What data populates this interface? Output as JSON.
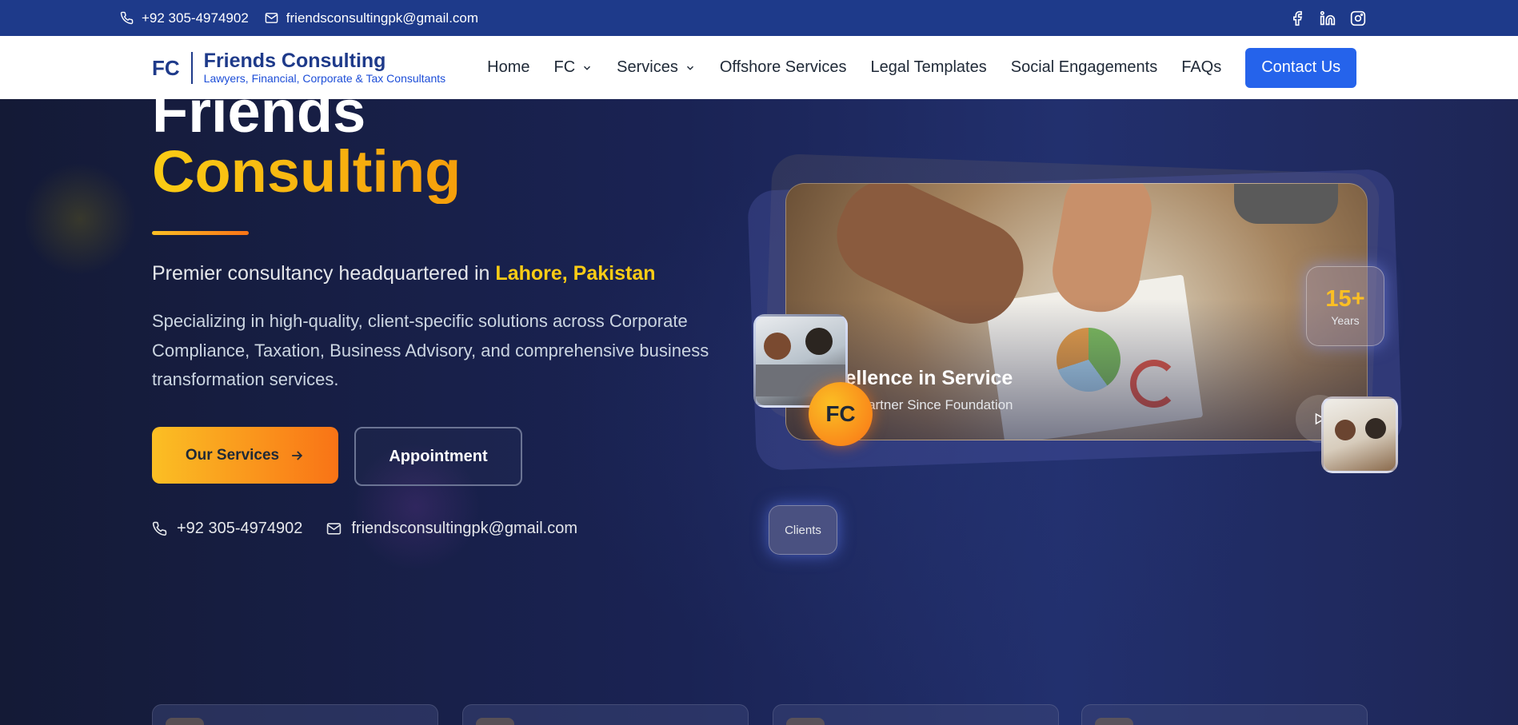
{
  "topbar": {
    "phone": "+92 305-4974902",
    "email": "friendsconsultingpk@gmail.com",
    "social": [
      "facebook-icon",
      "linkedin-icon",
      "instagram-icon"
    ]
  },
  "header": {
    "logo_mark": "FC",
    "brand_name": "Friends Consulting",
    "tagline": "Lawyers, Financial, Corporate & Tax Consultants",
    "nav": [
      {
        "label": "Home"
      },
      {
        "label": "FC"
      },
      {
        "label": "Services"
      },
      {
        "label": "Offshore Services"
      },
      {
        "label": "Legal Templates"
      },
      {
        "label": "Social Engagements"
      },
      {
        "label": "FAQs"
      }
    ],
    "cta": "Contact Us"
  },
  "hero": {
    "title_line1": "Friends",
    "title_line2": "Consulting",
    "subtitle_prefix": "Premier consultancy headquartered in",
    "subtitle_highlight": "Lahore, Pakistan",
    "description": "Specializing in high-quality, client-specific solutions across Corporate Compliance, Taxation, Business Advisory, and comprehensive business transformation services.",
    "primary_button": "Our Services",
    "secondary_button": "Appointment",
    "phone": "+92 305-4974902",
    "email": "friendsconsultingpk@gmail.com"
  },
  "showcase": {
    "badge": "FC",
    "title": "Excellence in Service",
    "subtitle": "Trusted Partner Since Foundation",
    "years_value": "15+",
    "years_label": "Years",
    "clients_label": "Clients"
  },
  "colors": {
    "topbar": "#1e3a8a",
    "accent_blue": "#2563eb",
    "accent_gold": "#fbbf24",
    "accent_orange": "#f97316"
  }
}
